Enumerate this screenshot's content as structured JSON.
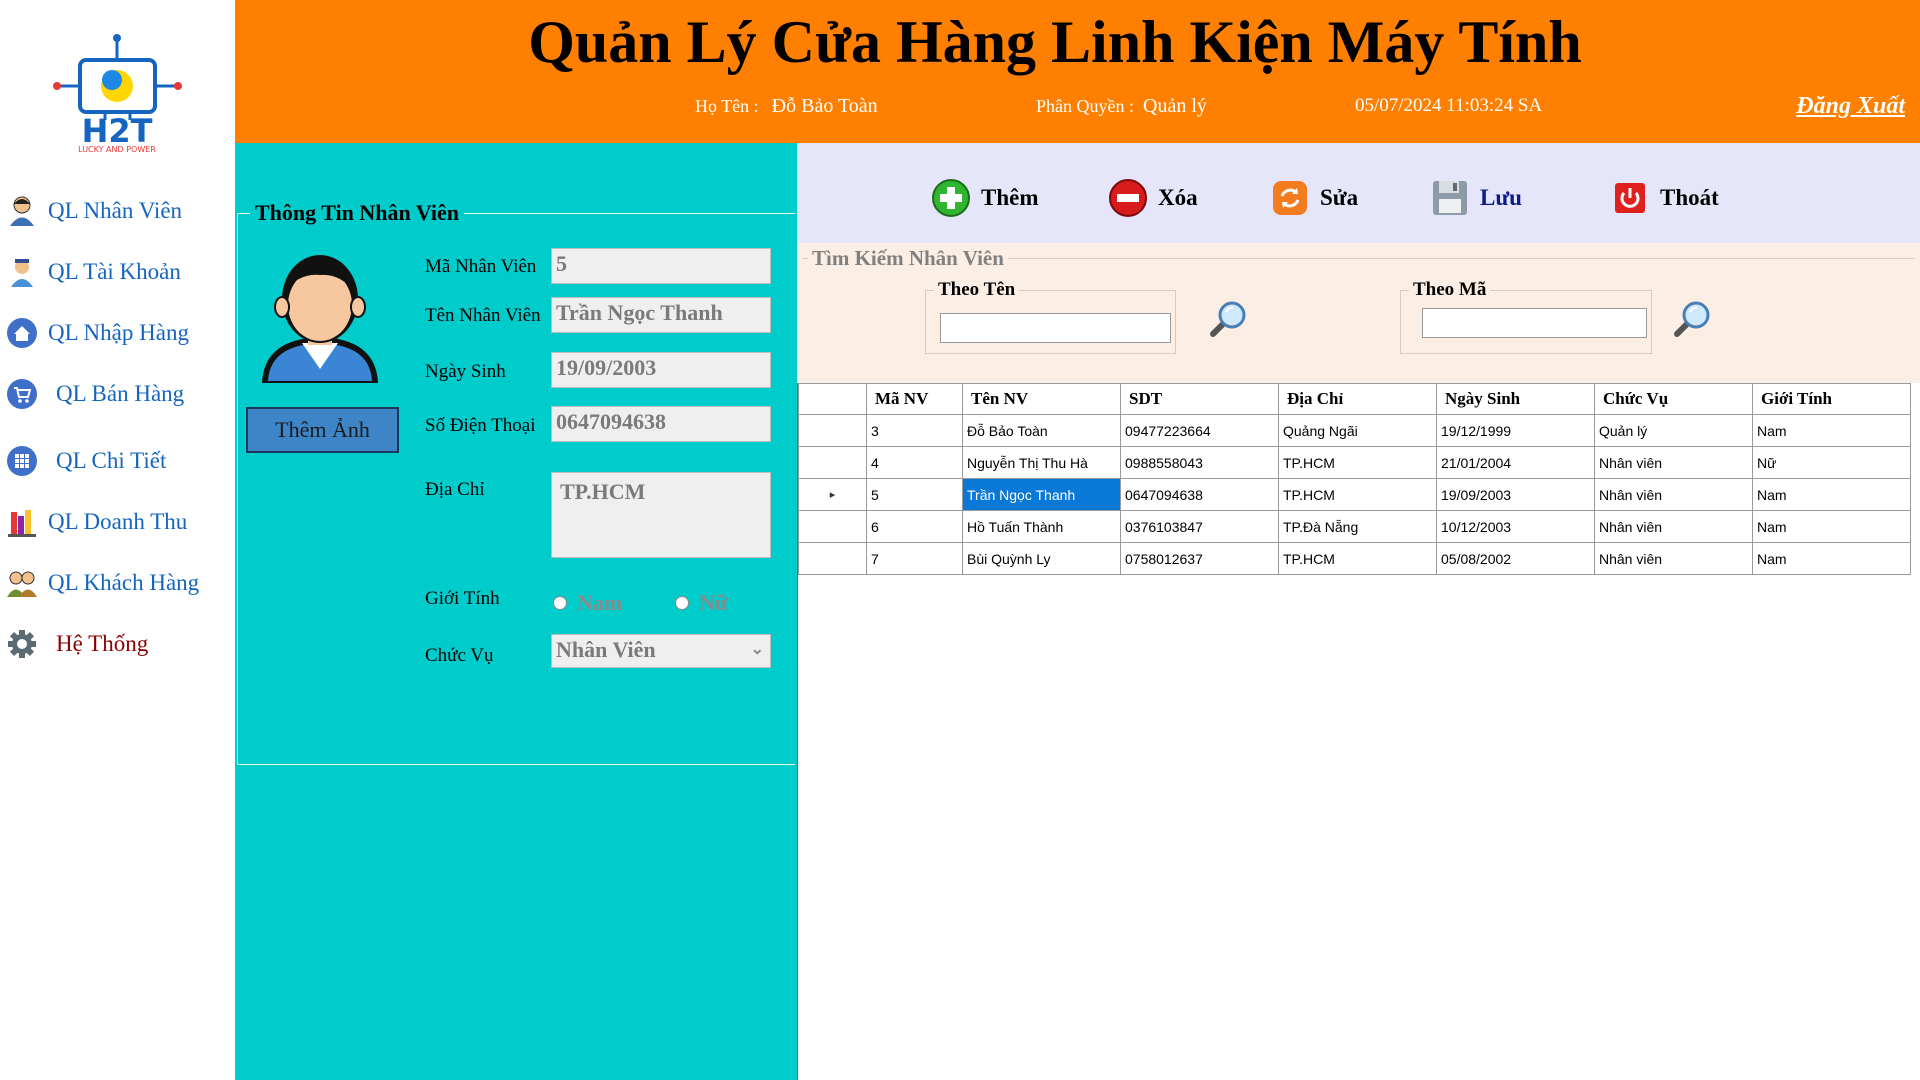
{
  "header": {
    "title": "Quản Lý Cửa Hàng Linh Kiện Máy Tính",
    "name_label": "Họ Tên :",
    "name_value": "Đỗ Bảo Toàn",
    "role_label": "Phân Quyền :",
    "role_value": "Quản lý",
    "datetime": "05/07/2024 11:03:24 SA",
    "logout": "Đăng Xuất"
  },
  "logo": {
    "text": "H2T",
    "tagline": "LUCKY AND POWER"
  },
  "sidebar": {
    "items": [
      {
        "label": "QL Nhân Viên",
        "icon": "employee-icon"
      },
      {
        "label": "QL Tài Khoản",
        "icon": "account-icon"
      },
      {
        "label": "QL Nhập Hàng",
        "icon": "home-import-icon"
      },
      {
        "label": "QL Bán Hàng",
        "icon": "cart-icon"
      },
      {
        "label": "QL Chi Tiết",
        "icon": "grid-detail-icon"
      },
      {
        "label": "QL Doanh Thu",
        "icon": "revenue-books-icon"
      },
      {
        "label": "QL Khách Hàng",
        "icon": "customers-icon"
      },
      {
        "label": "Hệ Thống",
        "icon": "gear-icon"
      }
    ]
  },
  "info": {
    "legend": "Thông Tin Nhân Viên",
    "add_photo": "Thêm Ảnh",
    "fields": {
      "id_label": "Mã Nhân Viên",
      "id_value": "5",
      "name_label": "Tên Nhân Viên",
      "name_value": "Trần Ngọc Thanh",
      "dob_label": "Ngày Sinh",
      "dob_value": "19/09/2003",
      "phone_label": "Số Điện Thoại",
      "phone_value": "0647094638",
      "address_label": "Địa Chỉ",
      "address_value": "TP.HCM",
      "gender_label": "Giới Tính",
      "gender_male": "Nam",
      "gender_female": "Nữ",
      "role_label": "Chức Vụ",
      "role_value": "Nhân Viên"
    }
  },
  "toolbar": {
    "add": "Thêm",
    "delete": "Xóa",
    "edit": "Sửa",
    "save": "Lưu",
    "exit": "Thoát"
  },
  "search": {
    "legend": "Tìm Kiếm Nhân Viên",
    "by_name": "Theo Tên",
    "by_id": "Theo Mã"
  },
  "table": {
    "headers": [
      "Mã NV",
      "Tên NV",
      "SDT",
      "Địa Chỉ",
      "Ngày Sinh",
      "Chức Vụ",
      "Giới Tính"
    ],
    "rows": [
      [
        "3",
        "Đỗ Bảo Toàn",
        "09477223664",
        "Quảng Ngãi",
        "19/12/1999",
        "Quản lý",
        "Nam"
      ],
      [
        "4",
        "Nguyễn Thị Thu Hà",
        "0988558043",
        "TP.HCM",
        "21/01/2004",
        "Nhân viên",
        "Nữ"
      ],
      [
        "5",
        "Trần Ngọc Thanh",
        "0647094638",
        "TP.HCM",
        "19/09/2003",
        "Nhân viên",
        "Nam"
      ],
      [
        "6",
        "Hồ Tuấn Thành",
        "0376103847",
        "TP.Đà Nẵng",
        "10/12/2003",
        "Nhân viên",
        "Nam"
      ],
      [
        "7",
        "Bùi Quỳnh Ly",
        "0758012637",
        "TP.HCM",
        "05/08/2002",
        "Nhân viên",
        "Nam"
      ]
    ],
    "selected_row": 2,
    "row_marker": "▸"
  }
}
